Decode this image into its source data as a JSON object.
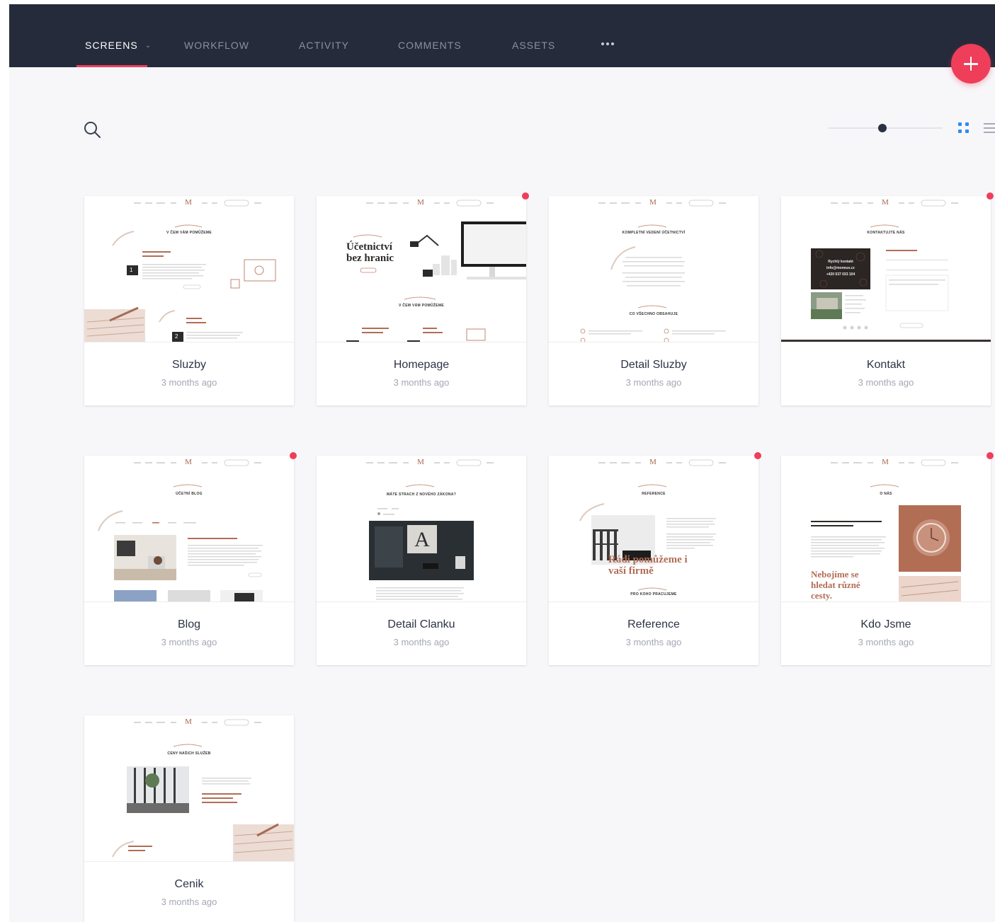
{
  "nav": {
    "tabs": [
      {
        "label": "SCREENS",
        "active": true,
        "has_dropdown": true
      },
      {
        "label": "WORKFLOW",
        "active": false
      },
      {
        "label": "ACTIVITY",
        "active": false
      },
      {
        "label": "COMMENTS",
        "active": false
      },
      {
        "label": "ASSETS",
        "active": false
      }
    ],
    "more_icon": "more-horizontal-icon",
    "add_icon": "plus-icon"
  },
  "toolbar": {
    "search_icon": "search-icon",
    "zoom_level": 0.45,
    "view_modes": [
      {
        "name": "grid",
        "active": true
      },
      {
        "name": "list",
        "active": false
      }
    ]
  },
  "colors": {
    "nav_bg": "#252b3b",
    "accent": "#ef3e5a",
    "grid_active": "#2f8bf0",
    "thumbnail_rust": "#b26d55"
  },
  "screens": [
    {
      "name": "Sluzby",
      "updated": "3 months ago",
      "has_comments": false,
      "thumb": {
        "section_title": "V ČEM VÁM POMŮŽEME",
        "headline": "",
        "steps": [
          "1",
          "2"
        ]
      }
    },
    {
      "name": "Homepage",
      "updated": "3 months ago",
      "has_comments": true,
      "thumb": {
        "section_title": "V ČEM VÁM POMŮŽEME",
        "headline": "Účetnictví bez hranic"
      }
    },
    {
      "name": "Detail Sluzby",
      "updated": "3 months ago",
      "has_comments": false,
      "thumb": {
        "section_title": "KOMPLETNÍ VEDENÍ ÚČETNICTVÍ",
        "headline": "",
        "subtitle": "CO VŠECHNO OBSAHUJE"
      }
    },
    {
      "name": "Kontakt",
      "updated": "3 months ago",
      "has_comments": true,
      "thumb": {
        "section_title": "KONTAKTUJTE NÁS",
        "headline": "",
        "contact_heading": "Rychlý kontakt",
        "contact_email": "info@moneus.cz",
        "contact_phone": "+420 537 033 104"
      }
    },
    {
      "name": "Blog",
      "updated": "3 months ago",
      "has_comments": true,
      "thumb": {
        "section_title": "ÚČETNÍ BLOG",
        "headline": ""
      }
    },
    {
      "name": "Detail Clanku",
      "updated": "3 months ago",
      "has_comments": false,
      "thumb": {
        "section_title": "MÁTE STRACH Z NOVÉHO ZÁKONA?",
        "headline": ""
      }
    },
    {
      "name": "Reference",
      "updated": "3 months ago",
      "has_comments": true,
      "thumb": {
        "section_title": "REFERENCE",
        "headline": "Rádi pomůžeme i vaší firmě",
        "subtitle": "PRO KOHO PRACUJEME"
      }
    },
    {
      "name": "Kdo Jsme",
      "updated": "3 months ago",
      "has_comments": true,
      "thumb": {
        "section_title": "O NÁS",
        "headline": "Nebojíme se hledat různé cesty."
      }
    },
    {
      "name": "Cenik",
      "updated": "3 months ago",
      "has_comments": false,
      "thumb": {
        "section_title": "CENY NAŠICH SLUŽEB",
        "headline": ""
      }
    }
  ]
}
